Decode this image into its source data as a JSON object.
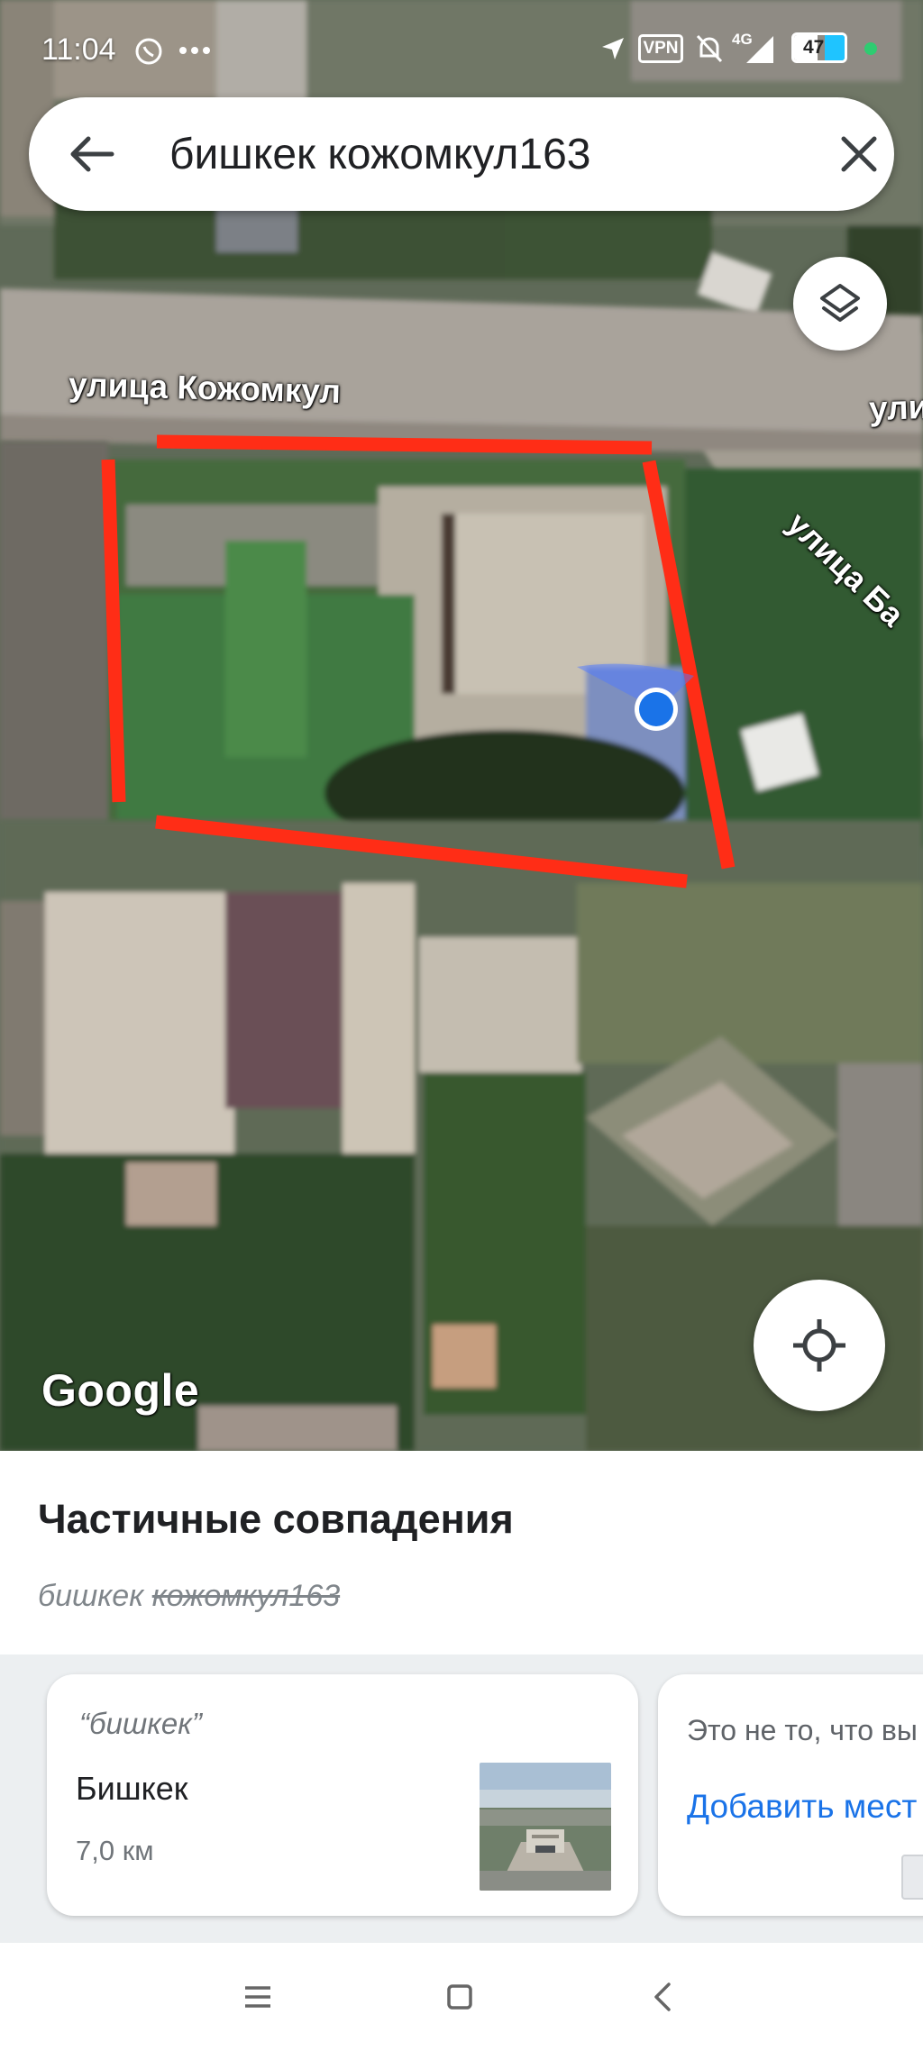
{
  "status_bar": {
    "time": "11:04",
    "vpn_label": "VPN",
    "network": "4G",
    "battery": "47",
    "icons": [
      "whatsapp-icon",
      "more-dots-icon",
      "location-arrow-icon",
      "vpn-icon",
      "mute-bell-icon",
      "signal-icon",
      "battery-icon",
      "dot-icon"
    ]
  },
  "search": {
    "query": "бишкек кожомкул163",
    "back_icon": "arrow-left-icon",
    "clear_icon": "close-icon"
  },
  "map": {
    "streets": [
      "улица Кожомкул",
      "ули",
      "улица Ба"
    ],
    "attribution": "Google",
    "layers_icon": "layers-icon",
    "locate_icon": "my-location-icon",
    "marker_color": "#1a73e8",
    "outline_color": "#ff2d16"
  },
  "results": {
    "heading": "Частичные совпадения",
    "subline_keep": "бишкек",
    "subline_strike": "кожомкул163"
  },
  "cards": [
    {
      "quoted": "“бишкек”",
      "name": "Бишкек",
      "distance": "7,0 км"
    },
    {
      "question": "Это не то, что вы",
      "action": "Добавить мест"
    }
  ],
  "nav_bar": {
    "icons": [
      "menu-icon",
      "home-square-icon",
      "back-chevron-icon"
    ]
  }
}
